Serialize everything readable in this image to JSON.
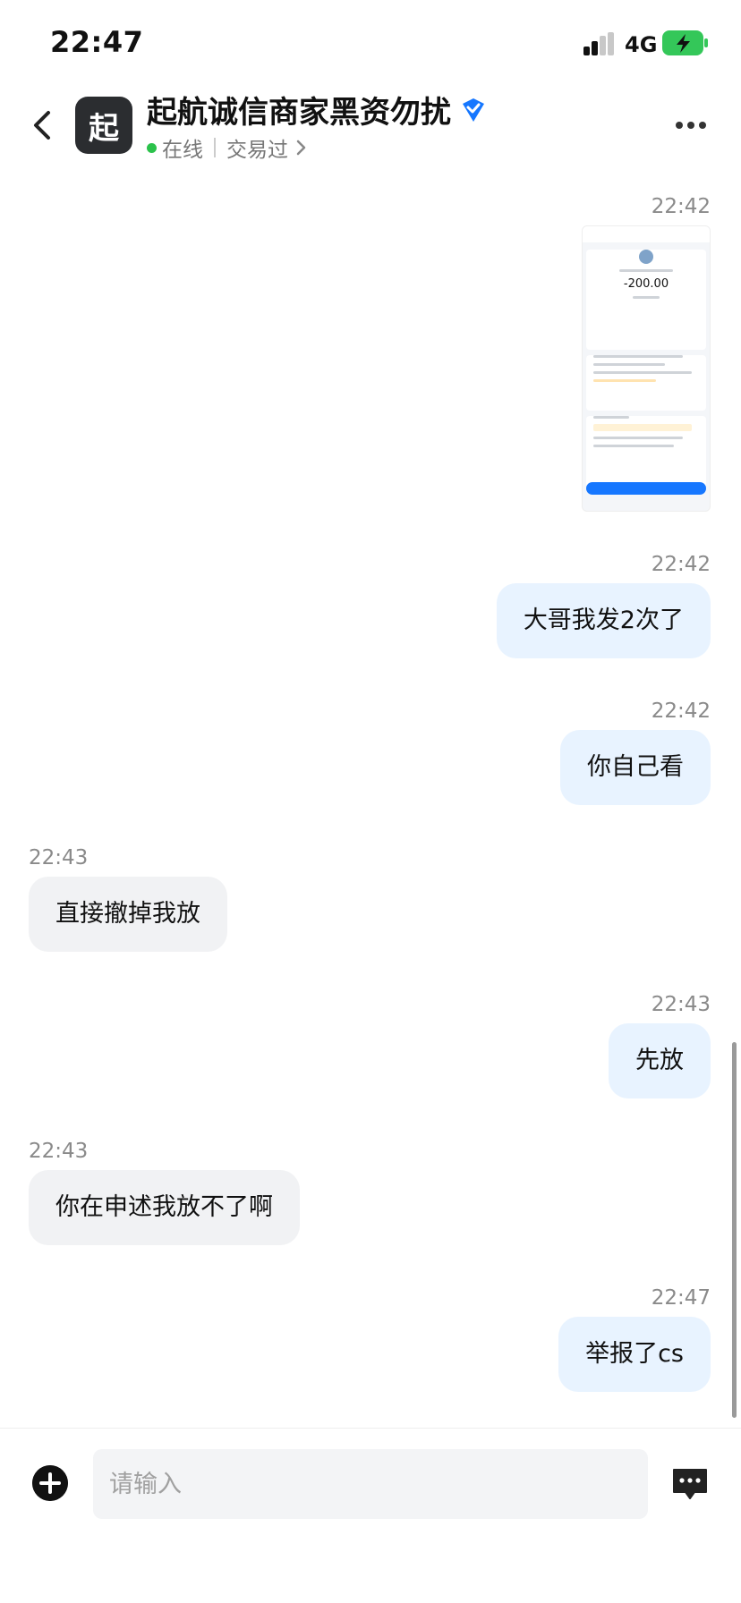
{
  "status_bar": {
    "time": "22:47",
    "network": "4G",
    "icons": [
      "signal-icon",
      "battery-charging-icon"
    ]
  },
  "header": {
    "avatar_char": "起",
    "title": "起航诚信商家黑资勿扰",
    "online": "在线",
    "traded": "交易过",
    "icons": [
      "back-icon",
      "verified-icon",
      "chevron-right-icon",
      "more-icon"
    ]
  },
  "messages": [
    {
      "side": "right",
      "time": "22:42",
      "type": "image"
    },
    {
      "side": "right",
      "time": "22:42",
      "text": "大哥我发2次了"
    },
    {
      "side": "right",
      "time": "22:42",
      "text": "你自己看"
    },
    {
      "side": "left",
      "time": "22:43",
      "text": "直接撤掉我放"
    },
    {
      "side": "right",
      "time": "22:43",
      "text": "先放"
    },
    {
      "side": "left",
      "time": "22:43",
      "text": "你在申述我放不了啊"
    },
    {
      "side": "right",
      "time": "22:47",
      "text": "举报了cs"
    }
  ],
  "thumbnail": {
    "amount": "-200.00"
  },
  "input": {
    "placeholder": "请输入"
  },
  "colors": {
    "accent": "#1677ff",
    "online": "#2bc24b",
    "bubble_right": "#e8f3ff",
    "bubble_left": "#f1f2f4"
  }
}
